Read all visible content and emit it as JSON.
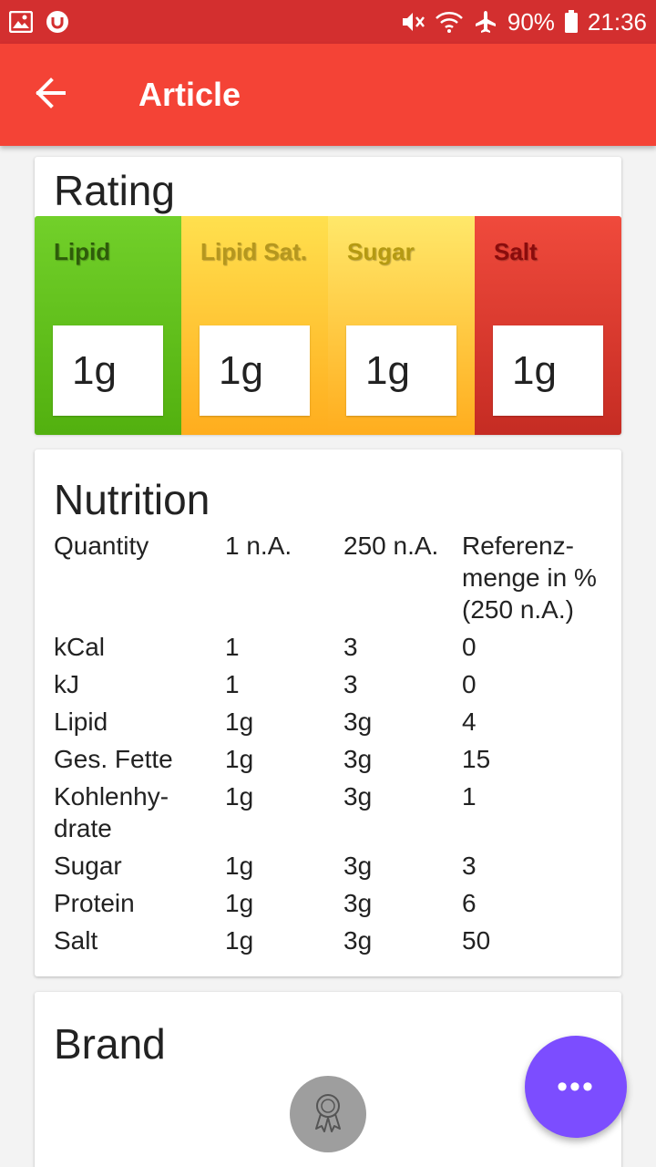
{
  "status_bar": {
    "battery": "90%",
    "time": "21:36",
    "icons": [
      "image-icon",
      "app-u-icon",
      "mute-icon",
      "wifi-icon",
      "airplane-icon",
      "battery-icon"
    ]
  },
  "app_bar": {
    "title": "Article",
    "back_icon": "arrow-back-icon",
    "color": "#f44336"
  },
  "rating": {
    "title": "Rating",
    "tiles": [
      {
        "label": "Lipid",
        "value": "1g",
        "level": "green"
      },
      {
        "label": "Lipid Sat.",
        "value": "1g",
        "level": "yellow"
      },
      {
        "label": "Sugar",
        "value": "1g",
        "level": "yellow"
      },
      {
        "label": "Salt",
        "value": "1g",
        "level": "red"
      }
    ]
  },
  "nutrition": {
    "title": "Nutrition",
    "header": [
      "Quantity",
      "1 n.A.",
      "250 n.A.",
      "Referenz-menge in %(250 n.A.)"
    ],
    "rows": [
      [
        "kCal",
        "1",
        "3",
        "0"
      ],
      [
        "kJ",
        "1",
        "3",
        "0"
      ],
      [
        "Lipid",
        "1g",
        "3g",
        "4"
      ],
      [
        "Ges. Fette",
        "1g",
        "3g",
        "15"
      ],
      [
        "Kohlenhy-drate",
        "1g",
        "3g",
        "1"
      ],
      [
        "Sugar",
        "1g",
        "3g",
        "3"
      ],
      [
        "Protein",
        "1g",
        "3g",
        "6"
      ],
      [
        "Salt",
        "1g",
        "3g",
        "50"
      ]
    ]
  },
  "brand": {
    "title": "Brand",
    "logo_icon": "award-badge-icon"
  },
  "fab": {
    "label": "•••",
    "icon": "more-horiz-icon",
    "color": "#7c4dff"
  }
}
